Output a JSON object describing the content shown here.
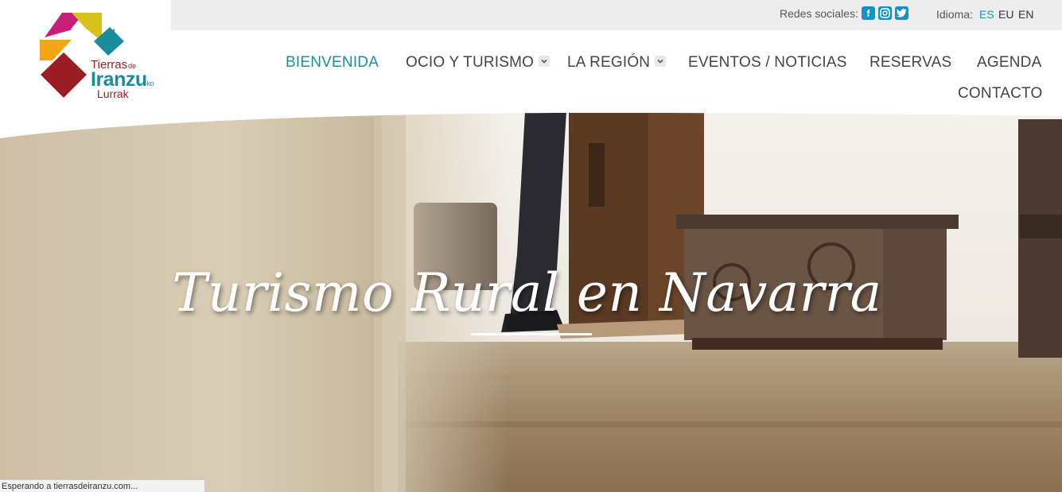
{
  "logo": {
    "line1": "Tierras",
    "line1_small": "de",
    "line2": "Iranzu",
    "line2_small": "ko",
    "line3": "Lurrak"
  },
  "topbar": {
    "social_label": "Redes sociales:",
    "social_icons": [
      "facebook-icon",
      "instagram-icon",
      "twitter-icon"
    ],
    "language_label": "Idioma:",
    "languages": [
      {
        "code": "ES",
        "active": true
      },
      {
        "code": "EU",
        "active": false
      },
      {
        "code": "EN",
        "active": false
      }
    ]
  },
  "nav": {
    "items": [
      {
        "label": "BIENVENIDA",
        "active": true
      },
      {
        "label": "OCIO Y TURISMO",
        "dropdown": true
      },
      {
        "label": "LA REGIÓN",
        "dropdown": true
      },
      {
        "label": "EVENTOS / NOTICIAS"
      },
      {
        "label": "RESERVAS"
      },
      {
        "label": "AGENDA"
      },
      {
        "label": "CONTACTO"
      }
    ]
  },
  "hero": {
    "title": "Turismo Rural en Navarra"
  },
  "status_bar": "Esperando a tierrasdeiranzu.com...",
  "colors": {
    "accent": "#1a8fa0",
    "icon_blue": "#1591c8",
    "logo_magenta": "#c6207a",
    "logo_yellow": "#d6c21a",
    "logo_teal": "#1b8c9e",
    "logo_orange": "#f2a614",
    "logo_red": "#9b1d24"
  }
}
